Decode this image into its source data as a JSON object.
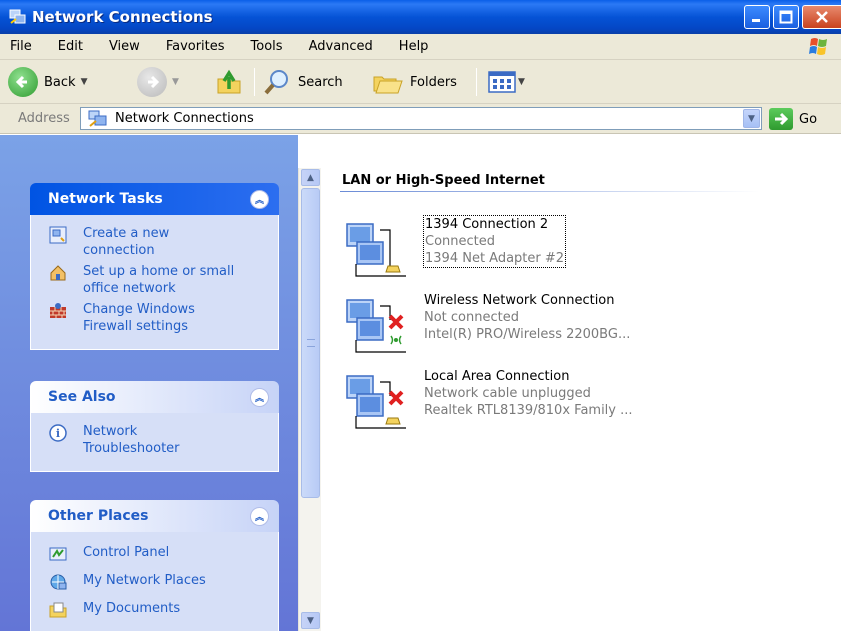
{
  "window": {
    "title": "Network Connections"
  },
  "menu": [
    "File",
    "Edit",
    "View",
    "Favorites",
    "Tools",
    "Advanced",
    "Help"
  ],
  "toolbar": {
    "back_label": "Back",
    "search_label": "Search",
    "folders_label": "Folders"
  },
  "address": {
    "label": "Address",
    "value": "Network Connections",
    "go_label": "Go"
  },
  "panels": {
    "network_tasks": {
      "title": "Network Tasks",
      "items": [
        {
          "label": "Create a new\nconnection",
          "icon": "new-connection-icon"
        },
        {
          "label": "Set up a home or small\noffice network",
          "icon": "home-network-icon"
        },
        {
          "label": "Change Windows\nFirewall settings",
          "icon": "firewall-icon"
        }
      ]
    },
    "see_also": {
      "title": "See Also",
      "items": [
        {
          "label": "Network\nTroubleshooter",
          "icon": "help-icon"
        }
      ]
    },
    "other_places": {
      "title": "Other Places",
      "items": [
        {
          "label": "Control Panel",
          "icon": "control-panel-icon"
        },
        {
          "label": "My Network Places",
          "icon": "network-places-icon"
        },
        {
          "label": "My Documents",
          "icon": "documents-icon"
        }
      ]
    }
  },
  "content": {
    "group_title": "LAN or High-Speed Internet",
    "connections": [
      {
        "name": "1394 Connection 2",
        "status": "Connected",
        "device": "1394 Net Adapter #2",
        "icon": "network-connection-icon",
        "disconnected": false,
        "wireless": false
      },
      {
        "name": "Wireless Network Connection",
        "status": "Not connected",
        "device": "Intel(R) PRO/Wireless 2200BG...",
        "icon": "wireless-connection-icon",
        "disconnected": true,
        "wireless": true
      },
      {
        "name": "Local Area Connection",
        "status": "Network cable unplugged",
        "device": "Realtek RTL8139/810x Family ...",
        "icon": "lan-connection-icon",
        "disconnected": true,
        "wireless": false
      }
    ]
  },
  "colors": {
    "titlebar": "#0553d6",
    "taskpane": "#7ba2e7",
    "link": "#215dc6",
    "error": "#e02020"
  }
}
